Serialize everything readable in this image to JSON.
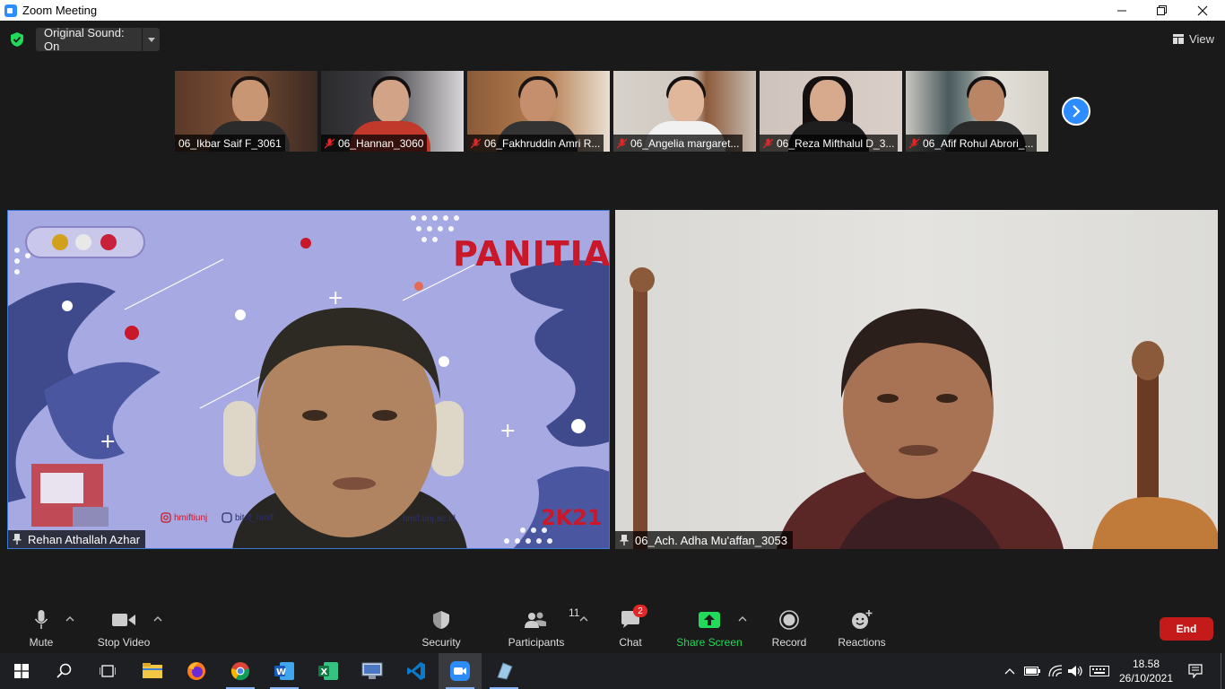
{
  "window": {
    "title": "Zoom Meeting",
    "controls": [
      "minimize-icon",
      "restore-icon",
      "close-icon"
    ]
  },
  "topbar": {
    "original_sound_label": "Original Sound: On",
    "view_label": "View"
  },
  "thumbnails": [
    {
      "name": "06_Ikbar Saif F_3061",
      "muted": false
    },
    {
      "name": "06_Hannan_3060",
      "muted": true
    },
    {
      "name": "06_Fakhruddin Amri R...",
      "muted": true
    },
    {
      "name": "06_Angelia margaret...",
      "muted": true
    },
    {
      "name": "06_Reza Mifthalul D_3...",
      "muted": true
    },
    {
      "name": "06_Afif Rohul Abrori_...",
      "muted": true
    }
  ],
  "main_videos": [
    {
      "name": "Rehan Athallah Azhar",
      "background_title": "PANITIA",
      "background_footer": "2K21",
      "background_social_1": "hmiftiunj",
      "background_social_2": "bit.if_hmif",
      "background_site": "hmif.unj.ac.id",
      "pinned": true
    },
    {
      "name": "06_Ach. Adha Mu'affan_3053",
      "pinned": true
    }
  ],
  "toolbar": {
    "mute_label": "Mute",
    "stop_video_label": "Stop Video",
    "security_label": "Security",
    "participants_label": "Participants",
    "participants_count": "11",
    "chat_label": "Chat",
    "chat_badge": "2",
    "share_screen_label": "Share Screen",
    "record_label": "Record",
    "reactions_label": "Reactions",
    "end_label": "End"
  },
  "colors": {
    "accent_blue": "#2d8cff",
    "share_green": "#23d959",
    "end_red": "#c41a1a",
    "dark_bg": "#1a1a1a"
  },
  "taskbar": {
    "apps": [
      "windows-start-icon",
      "search-icon",
      "task-view-icon",
      "file-explorer-icon",
      "firefox-icon",
      "chrome-icon",
      "word-icon",
      "excel-icon",
      "remote-desktop-icon",
      "vscode-icon",
      "zoom-icon",
      "app-icon"
    ],
    "time": "18.58",
    "date": "26/10/2021"
  }
}
